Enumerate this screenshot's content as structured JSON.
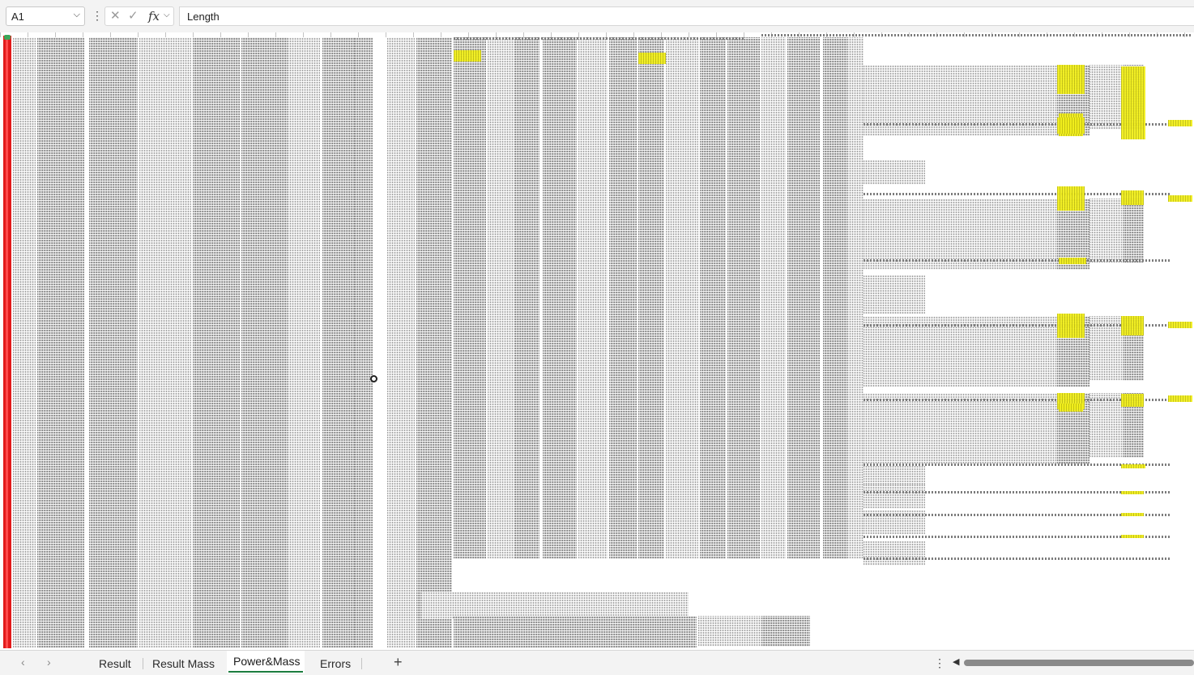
{
  "formula_bar": {
    "name_box": "A1",
    "formula": "Length",
    "icons": {
      "name_box_dropdown": "chevron-down-icon",
      "more_options": "vertical-ellipsis-icon",
      "cancel": "close-icon",
      "enter": "checkmark-icon",
      "insert_function": "fx-icon",
      "function_dropdown": "chevron-down-icon"
    },
    "glyphs": {
      "dropdown": "⌵",
      "ellipsis": "⋮",
      "cancel": "✕",
      "enter": "✓",
      "fx": "fx",
      "caret": "⌵"
    }
  },
  "sheet_tabs": {
    "tabs": [
      "Result",
      "Result Mass",
      "Power&Mass",
      "Errors"
    ],
    "active": "Power&Mass",
    "prev_icon": "‹",
    "next_icon": "›",
    "add_icon": "+",
    "menu_icon": "⋮",
    "scroll_left_icon": "◀"
  },
  "colors": {
    "row_highlight": "#e21b1b",
    "cell_highlight": "#f2ef1c",
    "active_tab_accent": "#1c7d3f"
  }
}
